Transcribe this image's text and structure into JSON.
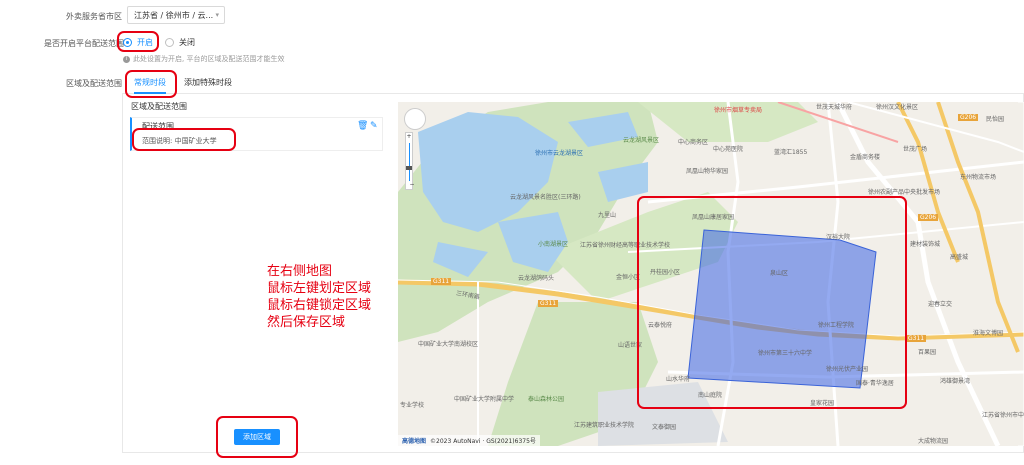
{
  "form": {
    "region_label": "外卖服务省市区",
    "region_value": "江苏省 / 徐州市 / 云...",
    "platform_label": "是否开启平台配送范围",
    "radio_on": "开启",
    "radio_off": "关闭",
    "hint": "此处设置为开启, 平台的区域及配送范围才能生效",
    "area_label": "区域及配送范围"
  },
  "tabs": [
    "常规时段",
    "添加特殊时段"
  ],
  "panel": {
    "title": "区域及配送范围",
    "card_title": "配送范围",
    "card_desc": "范围说明: 中国矿业大学",
    "add_button": "添加区域"
  },
  "annotation": [
    "在右侧地图",
    "鼠标左键划定区域",
    "鼠标右键锁定区域",
    "然后保存区域"
  ],
  "map": {
    "labels": {
      "l1": "徐州市烟草专卖局",
      "l2": "世茂天城华府",
      "l3": "徐州汉文化景区",
      "l4": "民怡园",
      "l5": "中心苑医院",
      "l6": "蓝湾汇1855",
      "l7": "金盾商务楼",
      "l8": "世茂广场",
      "l9": "云龙湖风景区",
      "l10": "徐州市云龙湖景区",
      "l11": "中心商务区",
      "l12": "云龙湖风景名胜区(三环路)",
      "l13": "凤凰山物华家园",
      "l14": "徐州农副产品中央批发市场",
      "l15": "东州物流市场",
      "l16": "凤凰山康居家园",
      "l17": "汉裕大院",
      "l18": "江苏省徐州财经高等职业技术学校",
      "l19": "小南湖景区",
      "l20": "云龙湖鸽码头",
      "l21": "金恒小区",
      "l22": "丹桂园小区",
      "l23": "泉山区",
      "l24": "徐州工程学院",
      "l25": "云泰悦府",
      "l26": "山语世家",
      "l27": "徐州市第三十六中学",
      "l28": "山水华府",
      "l29": "南山庭院",
      "l30": "国泰·青华逸居",
      "l31": "鸿雄御景湾",
      "l32": "中国矿业大学南湖校区",
      "l33": "中国矿业大学附属中学",
      "l34": "江苏建筑职业技术学院",
      "l35": "文泰御园",
      "l36": "泰山森林公园",
      "l37": "徐州光伏产业园",
      "l38": "百果园",
      "l39": "淮海文博园",
      "l40": "九里山",
      "l41": "大成物流园",
      "l42": "江苏省徐州市中等专业学校",
      "l43": "专业学校",
      "l44": "皇家花园",
      "l45": "迎春立交",
      "l46": "高盛城",
      "l47": "建材装饰城"
    },
    "roads": {
      "r1": "G311",
      "r2": "G206",
      "r3": "G311",
      "r4": "G206",
      "r5": "G311",
      "r6": "三环南路"
    },
    "copyright_logo": "高德地图",
    "copyright_text": "©2023 AutoNavi · GS(2021)6375号"
  },
  "colors": {
    "accent": "#1890ff",
    "annotation": "#e60012",
    "polygon": "#3a63d8"
  }
}
